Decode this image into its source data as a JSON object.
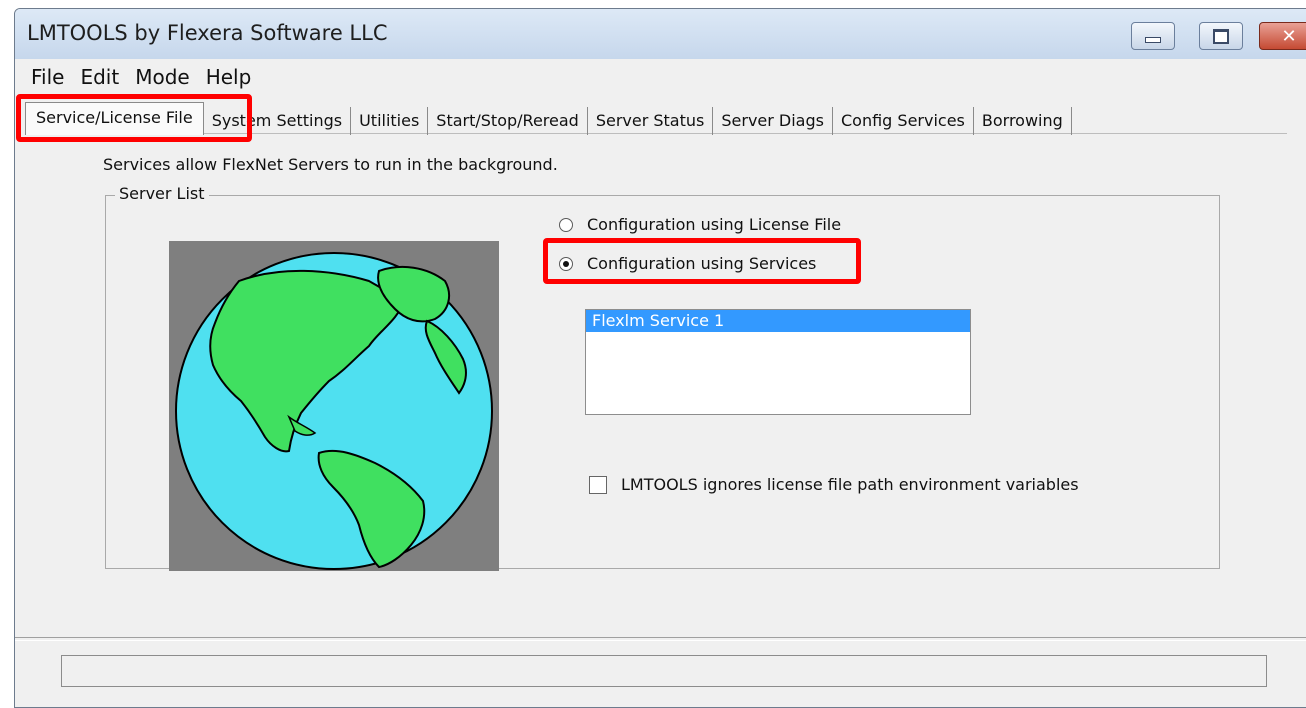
{
  "window": {
    "title": "LMTOOLS by Flexera Software LLC",
    "controls": {
      "minimize": "",
      "maximize": "",
      "close": "✕"
    }
  },
  "menu": [
    "File",
    "Edit",
    "Mode",
    "Help"
  ],
  "tabs": [
    "Service/License File",
    "System Settings",
    "Utilities",
    "Start/Stop/Reread",
    "Server Status",
    "Server Diags",
    "Config Services",
    "Borrowing"
  ],
  "active_tab": "Service/License File",
  "panel": {
    "description": "Services allow FlexNet Servers to run in the background.",
    "group_label": "Server List",
    "radio_license": "Configuration using License File",
    "radio_services": "Configuration using Services",
    "selected_radio": "services",
    "services_list": [
      "Flexlm Service 1"
    ],
    "checkbox_label": "LMTOOLS ignores license file path environment variables",
    "checkbox_checked": false
  },
  "colors": {
    "highlight": "#ff0000",
    "selection": "#3399ff",
    "globe_ocean": "#4fe0f0",
    "globe_land": "#40e060",
    "image_bg": "#7f7f7f"
  }
}
